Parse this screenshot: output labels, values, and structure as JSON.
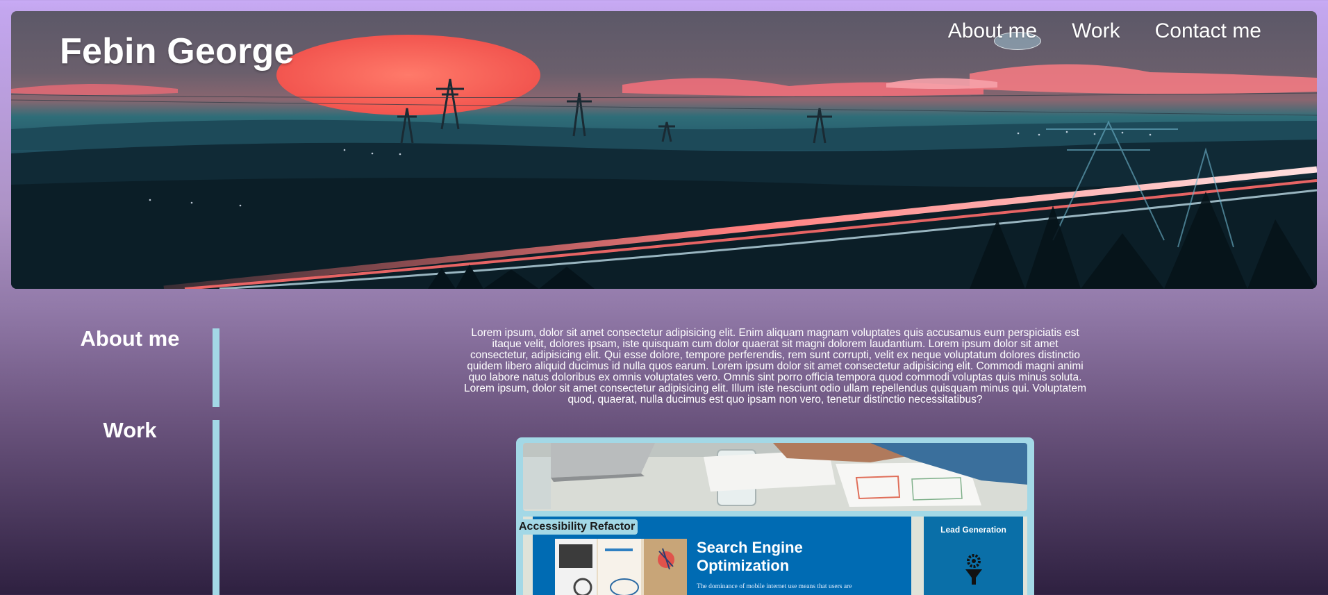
{
  "header": {
    "site_title": "Febin George",
    "nav": [
      {
        "label": "About me"
      },
      {
        "label": "Work"
      },
      {
        "label": "Contact me"
      }
    ]
  },
  "sidebar": {
    "about_heading": "About me",
    "work_heading": "Work"
  },
  "about": {
    "text": "Lorem ipsum, dolor sit amet consectetur adipisicing elit. Enim aliquam magnam voluptates quis accusamus eum perspiciatis est itaque velit, dolores ipsam, iste quisquam cum dolor quaerat sit magni dolorem laudantium. Lorem ipsum dolor sit amet consectetur, adipisicing elit. Qui esse dolore, tempore perferendis, rem sunt corrupti, velit ex neque voluptatum dolores distinctio quidem libero aliquid ducimus id nulla quos earum. Lorem ipsum dolor sit amet consectetur adipisicing elit. Commodi magni animi quo labore natus doloribus ex omnis voluptates vero. Omnis sint porro officia tempora quod commodi voluptas quis minus soluta. Lorem ipsum, dolor sit amet consectetur adipisicing elit. Illum iste nesciunt odio ullam repellendus quisquam minus qui. Voluptatem quod, quaerat, nulla ducimus est quo ipsam non vero, tenetur distinctio necessitatibus?"
  },
  "work": {
    "project_label": "Accessibility Refactor",
    "preview": {
      "seo_title": "Search Engine Optimization",
      "seo_body": "The dominance of mobile internet use means that users are",
      "lead_title": "Lead Generation"
    }
  },
  "colors": {
    "accent_bar": "#a3d8e6",
    "seo_blue": "#006bb3",
    "background_top": "#c8aaf5",
    "background_bottom": "#2e2040"
  }
}
